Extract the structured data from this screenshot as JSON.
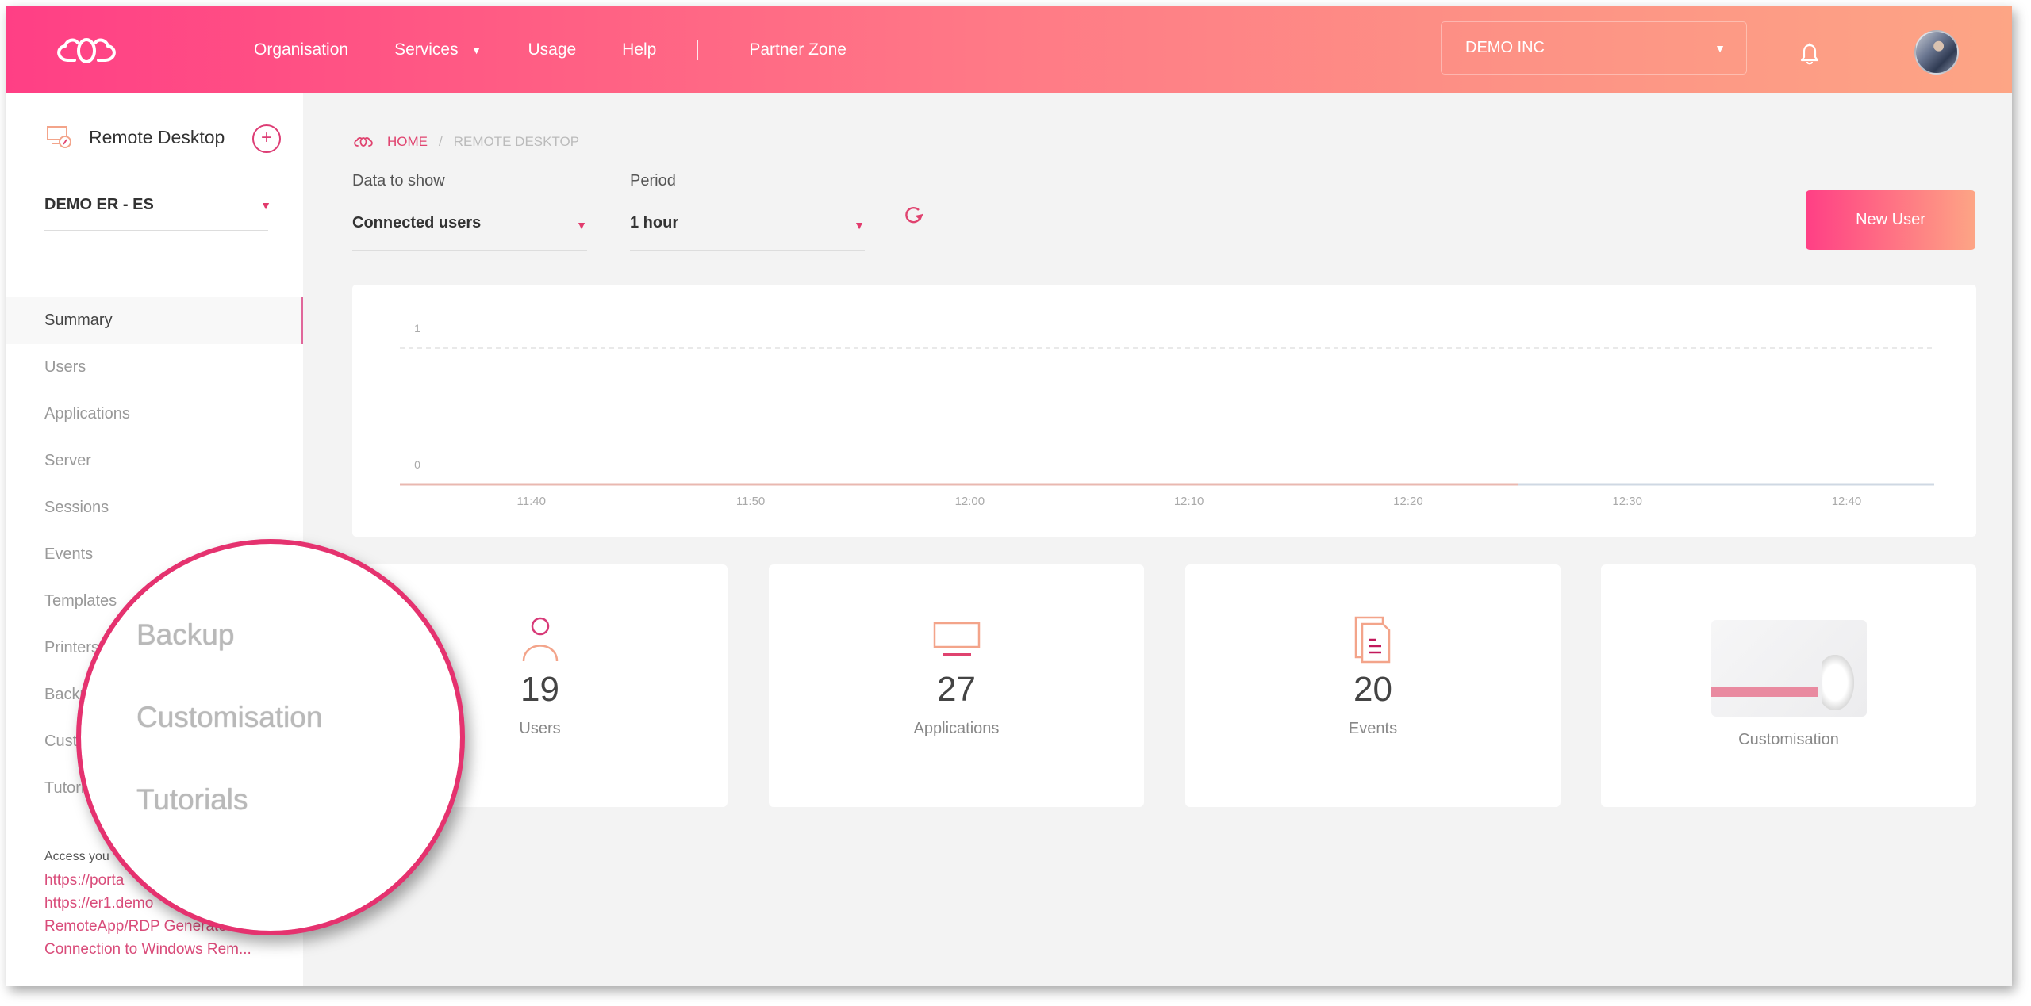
{
  "topbar": {
    "nav": [
      {
        "label": "Organisation"
      },
      {
        "label": "Services",
        "has_dropdown": true
      },
      {
        "label": "Usage"
      },
      {
        "label": "Help"
      },
      {
        "label": "Partner Zone"
      }
    ],
    "org_select": {
      "value": "DEMO INC"
    },
    "icons": {
      "logo": "cloud-logo-icon",
      "bell": "bell-icon",
      "avatar": "user-avatar"
    }
  },
  "sidebar": {
    "title": "Remote Desktop",
    "add_label": "+",
    "environment_select": {
      "value": "DEMO ER - ES"
    },
    "items": [
      {
        "label": "Summary",
        "active": true
      },
      {
        "label": "Users"
      },
      {
        "label": "Applications"
      },
      {
        "label": "Server"
      },
      {
        "label": "Sessions"
      },
      {
        "label": "Events"
      },
      {
        "label": "Templates"
      },
      {
        "label": "Printers"
      },
      {
        "label": "Backup"
      },
      {
        "label": "Customisation"
      },
      {
        "label": "Tutorials"
      }
    ],
    "footer": {
      "label": "Access you",
      "links": [
        {
          "text": "https://porta"
        },
        {
          "text": "https://er1.demo"
        },
        {
          "text": "RemoteApp/RDP Generator"
        },
        {
          "text": "Connection to Windows Rem..."
        }
      ]
    }
  },
  "magnifier": {
    "items": [
      {
        "label": "Printers"
      },
      {
        "label": "Backup"
      },
      {
        "label": "Customisation"
      },
      {
        "label": "Tutorials"
      }
    ]
  },
  "main": {
    "breadcrumb": {
      "home": "HOME",
      "separator": "/",
      "current": "REMOTE DESKTOP"
    },
    "data_to_show": {
      "label": "Data to show",
      "value": "Connected users"
    },
    "period": {
      "label": "Period",
      "value": "1 hour"
    },
    "new_user_label": "New User",
    "stats": [
      {
        "icon": "user-icon",
        "value": "19",
        "label": "Users"
      },
      {
        "icon": "monitor-icon",
        "value": "27",
        "label": "Applications"
      },
      {
        "icon": "documents-icon",
        "value": "20",
        "label": "Events"
      },
      {
        "icon": "customisation-thumbnail",
        "value": "",
        "label": "Customisation"
      }
    ]
  },
  "colors": {
    "accent": "#e5326f",
    "gradient_start": "#ff3f85",
    "gradient_end": "#fda585",
    "series_1": "#e9b8b0",
    "series_2": "#cfd8e3"
  },
  "chart_data": {
    "type": "line",
    "title": "",
    "xlabel": "",
    "ylabel": "",
    "x_ticks": [
      "11:40",
      "11:50",
      "12:00",
      "12:10",
      "12:20",
      "12:30",
      "12:40"
    ],
    "y_ticks": [
      "0",
      "1"
    ],
    "ylim": [
      0,
      1
    ],
    "xlim": [
      "11:34",
      "12:44"
    ],
    "grid": true,
    "legend": "none",
    "series": [
      {
        "name": "series-1",
        "x": [
          "11:34",
          "12:25"
        ],
        "values": [
          0,
          0
        ]
      },
      {
        "name": "series-2",
        "x": [
          "12:25",
          "12:44"
        ],
        "values": [
          0,
          0
        ]
      }
    ]
  }
}
